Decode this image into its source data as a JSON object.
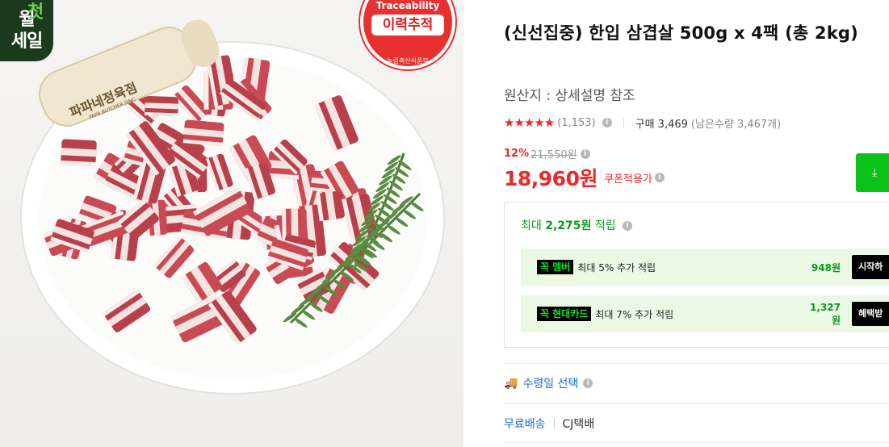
{
  "gallery": {
    "sale_badge_lines": [
      "월",
      "첫",
      "세일"
    ],
    "trace_badge": {
      "en": "Traceability",
      "ko": "이력추적",
      "ministry": "농림축산식품부"
    },
    "card_lines": [
      "파파네정육점",
      "PAPA BUTCHER SINC"
    ]
  },
  "product": {
    "title": "(신선집중) 한입 삼겹살 500g x 4팩 (총 2kg)",
    "origin": "원산지 : 상세설명 참조"
  },
  "rating": {
    "stars": "★★★★★",
    "review_count": "(1,153)",
    "sold_label": "구매 3,469",
    "remaining": "(남은수량 3,467개)"
  },
  "price": {
    "discount_rate": "12%",
    "original_price": "21,550원",
    "sale_price": "18,960원",
    "coupon_label": "쿠폰적용가",
    "download_icon": "⤓"
  },
  "points": {
    "head_prefix": "최대 ",
    "head_amount": "2,275원",
    "head_suffix": " 적립",
    "benefits": [
      {
        "tag": "꼭 멤버",
        "desc": "최대 5% 추가 적립",
        "amount": "948원",
        "cta": "시작하"
      },
      {
        "tag": "꼭 현대카드",
        "desc": "최대 7% 추가 적립",
        "amount": "1,327원",
        "cta": "혜택받"
      }
    ]
  },
  "delivery": {
    "date_label": "수령일 선택",
    "free_label": "무료배송",
    "carrier": "CJ택배"
  },
  "colors": {
    "accent_red": "#e82a2a",
    "green": "#0bc21a",
    "link_blue": "#1a6dd6"
  },
  "icons": {
    "info": "i",
    "truck": "🚚"
  }
}
